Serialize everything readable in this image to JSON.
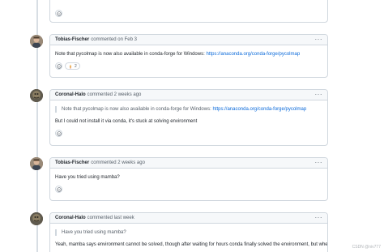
{
  "comments": [
    {
      "author": "Tobias-Fischer",
      "meta": "commented on Feb 3",
      "text_prefix": "Note that pycolmap is now also available in conda-forge for Windows: ",
      "link": "https://anaconda.org/conda-forge/pycolmap",
      "reaction_count": "2"
    },
    {
      "author": "Coronal-Halo",
      "meta": "commented 2 weeks ago",
      "quote_prefix": "Note that pycolmap is now also available in conda-forge for Windows: ",
      "quote_link": "https://anaconda.org/conda-forge/pycolmap",
      "text": "But I could not install it via conda, it's stuck at solving environment"
    },
    {
      "author": "Tobias-Fischer",
      "meta": "commented 2 weeks ago",
      "text": "Have you tried using mamba?"
    },
    {
      "author": "Coronal-Halo",
      "meta": "commented last week",
      "quote": "Have you tried using mamba?",
      "text": "Yeah, mamba says environment cannot be solved, though after waiting for hours conda finally solved the environment, but when I"
    }
  ],
  "icons": {
    "add_reaction": "smiley-icon",
    "menu": "kebab-icon",
    "rocket": "rocket-icon"
  },
  "watermark": "CSDN @niv777"
}
